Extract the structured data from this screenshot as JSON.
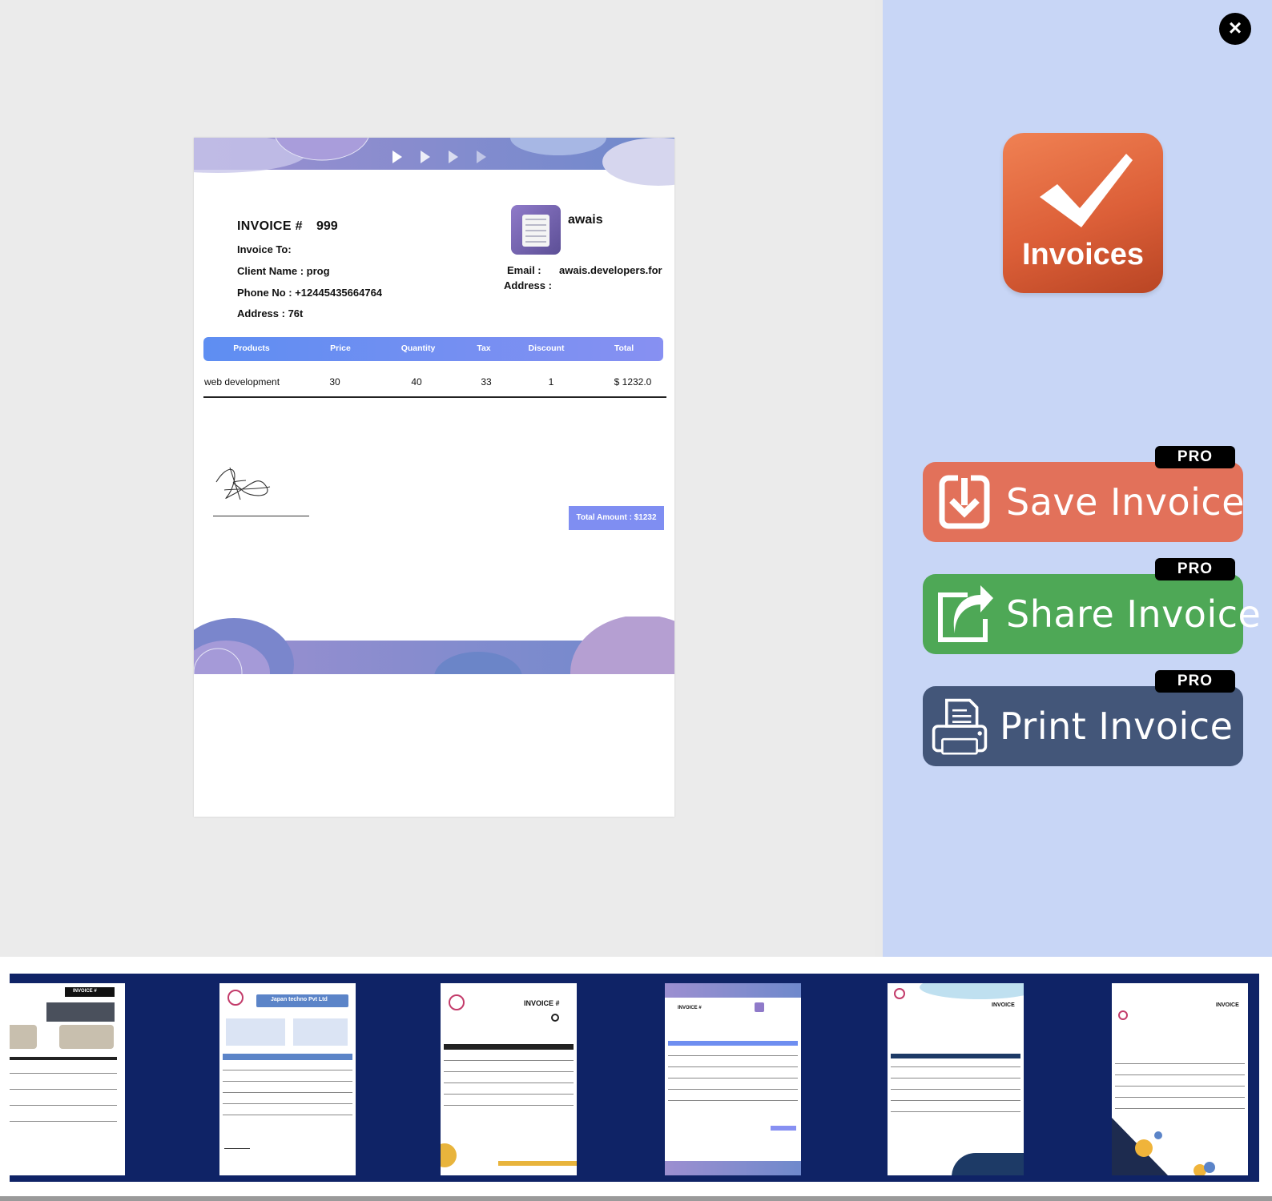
{
  "invoice": {
    "title": "INVOICE #",
    "number": "999",
    "invoice_to": "Invoice To:",
    "client_name": "Client Name : prog",
    "phone": "Phone No : +12445435664764",
    "address": "Address : 76t",
    "company_name": "awais",
    "email_label": "Email :",
    "email_value": "awais.developers.for",
    "address_label": "Address :",
    "columns": [
      "Products",
      "Price",
      "Quantity",
      "Tax",
      "Discount",
      "Total"
    ],
    "rows": [
      [
        "web development",
        "30",
        "40",
        "33",
        "1",
        "$ 1232.0"
      ]
    ],
    "total_amount": "Total Amount : $1232"
  },
  "side_panel": {
    "close_icon": "close-icon",
    "app_name": "Invoices",
    "buttons": [
      {
        "label": "Save Invoice",
        "badge": "PRO",
        "icon": "save-download-icon",
        "color": "#e2715a"
      },
      {
        "label": "Share Invoice",
        "badge": "PRO",
        "icon": "share-arrow-icon",
        "color": "#4ea856"
      },
      {
        "label": "Print Invoice",
        "badge": "PRO",
        "icon": "printer-icon",
        "color": "#435679"
      }
    ]
  },
  "templates": {
    "count": 6,
    "thumb_texts": [
      "INVOICE #",
      "Japan techno Pvt Ltd",
      "INVOICE #",
      "INVOICE #",
      "INVOICE",
      "INVOICE"
    ]
  },
  "colors": {
    "accent_blue": "#5e8ef2",
    "side_panel_bg": "#c8d6f6",
    "strip_bg": "#0f2366"
  }
}
